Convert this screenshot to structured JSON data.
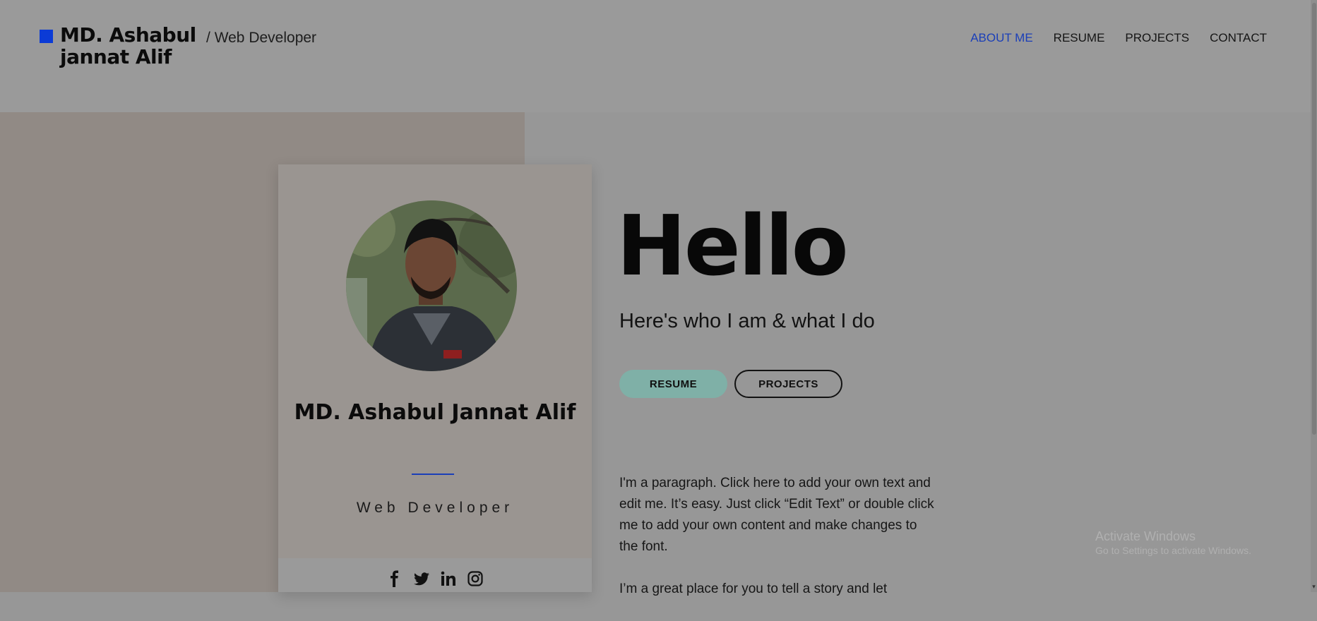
{
  "header": {
    "site_name": "MD. Ashabul jannat Alif",
    "separator": "/",
    "role": "Web Developer",
    "nav": [
      {
        "label": "ABOUT ME",
        "active": true
      },
      {
        "label": "RESUME",
        "active": false
      },
      {
        "label": "PROJECTS",
        "active": false
      },
      {
        "label": "CONTACT",
        "active": false
      }
    ]
  },
  "card": {
    "name": "MD. Ashabul Jannat Alif",
    "role": "Web Developer",
    "socials": [
      "facebook-icon",
      "twitter-icon",
      "linkedin-icon",
      "instagram-icon"
    ]
  },
  "main": {
    "greeting": "Hello",
    "tagline": "Here's who I am & what I do",
    "buttons": {
      "resume": "RESUME",
      "projects": "PROJECTS"
    },
    "paragraphs": [
      "I'm a paragraph. Click here to add your own text and edit me. It’s easy. Just click “Edit Text” or double click me to add your own content and make changes to the font.",
      "I’m a great place for you to tell a story and let"
    ]
  },
  "watermark": {
    "title": "Activate Windows",
    "subtitle": "Go to Settings to activate Windows."
  },
  "colors": {
    "accent": "#1b3fb8",
    "logo_square": "#0b3bd6",
    "resume_button": "#7fb0a7",
    "overlay_gray": "#979797"
  }
}
